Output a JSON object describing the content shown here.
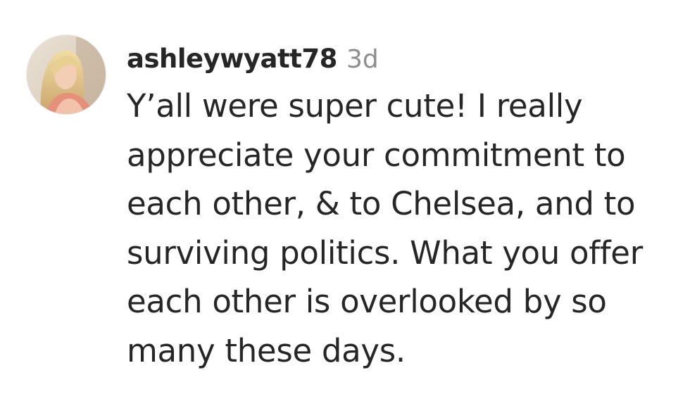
{
  "comment": {
    "avatar_icon": "user-profile-photo",
    "username": "ashleywyatt78",
    "age": "3d",
    "text": "Y’all were super cute! I really appreciate your commitment to each other, & to Chelsea, and to surviving politics. What you offer each other is overlooked by so many these days."
  },
  "colors": {
    "text": "#262626",
    "secondary": "#8e8e8e",
    "background": "#ffffff"
  }
}
